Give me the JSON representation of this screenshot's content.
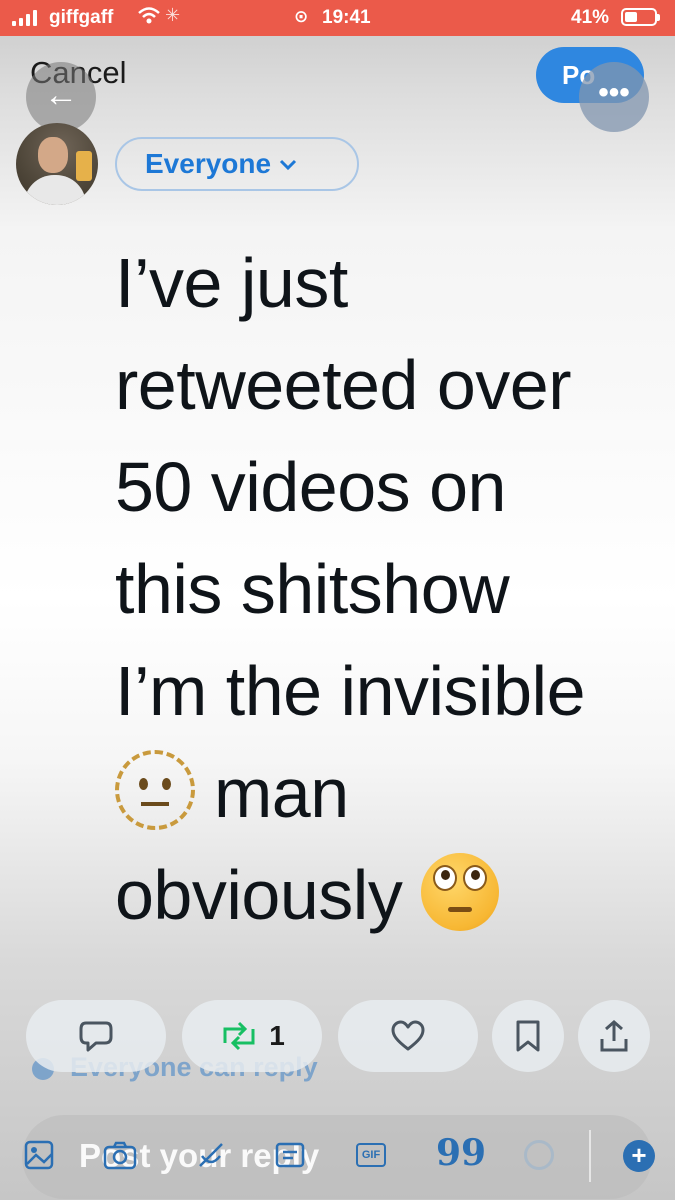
{
  "status_bar": {
    "carrier": "giffgaff",
    "time": "19:41",
    "battery": "41%",
    "wifi_icon": "📶",
    "activity_icon": "✳",
    "alarm_icon": "⊙"
  },
  "header": {
    "cancel_label": "Cancel",
    "post_label": "Po",
    "back_icon": "←",
    "more_icon": "•••"
  },
  "composer": {
    "audience_label": "Everyone",
    "audience_chevron": "⌄",
    "text_line1": "I’ve just",
    "text_line2": "retweeted over",
    "text_line3": "50 videos on",
    "text_line4": "this shitshow",
    "text_line5": "I’m the invisible",
    "text_line6_after_emoji": "man",
    "text_line7": "obviously",
    "emoji_1": "neutral-face",
    "emoji_2": "face-with-rolling-eyes",
    "reply_settings": "Everyone can reply"
  },
  "actions": {
    "retweet_count": "1"
  },
  "reply_bar": {
    "placeholder": "Post your reply",
    "gif_label": "GIF",
    "quote_icon": "99",
    "add_icon": "+"
  },
  "colors": {
    "status_bar": "#eb5a4a",
    "accent_blue": "#1d78d6",
    "post_button": "#2f87e0",
    "retweet_green": "#17bf63"
  }
}
